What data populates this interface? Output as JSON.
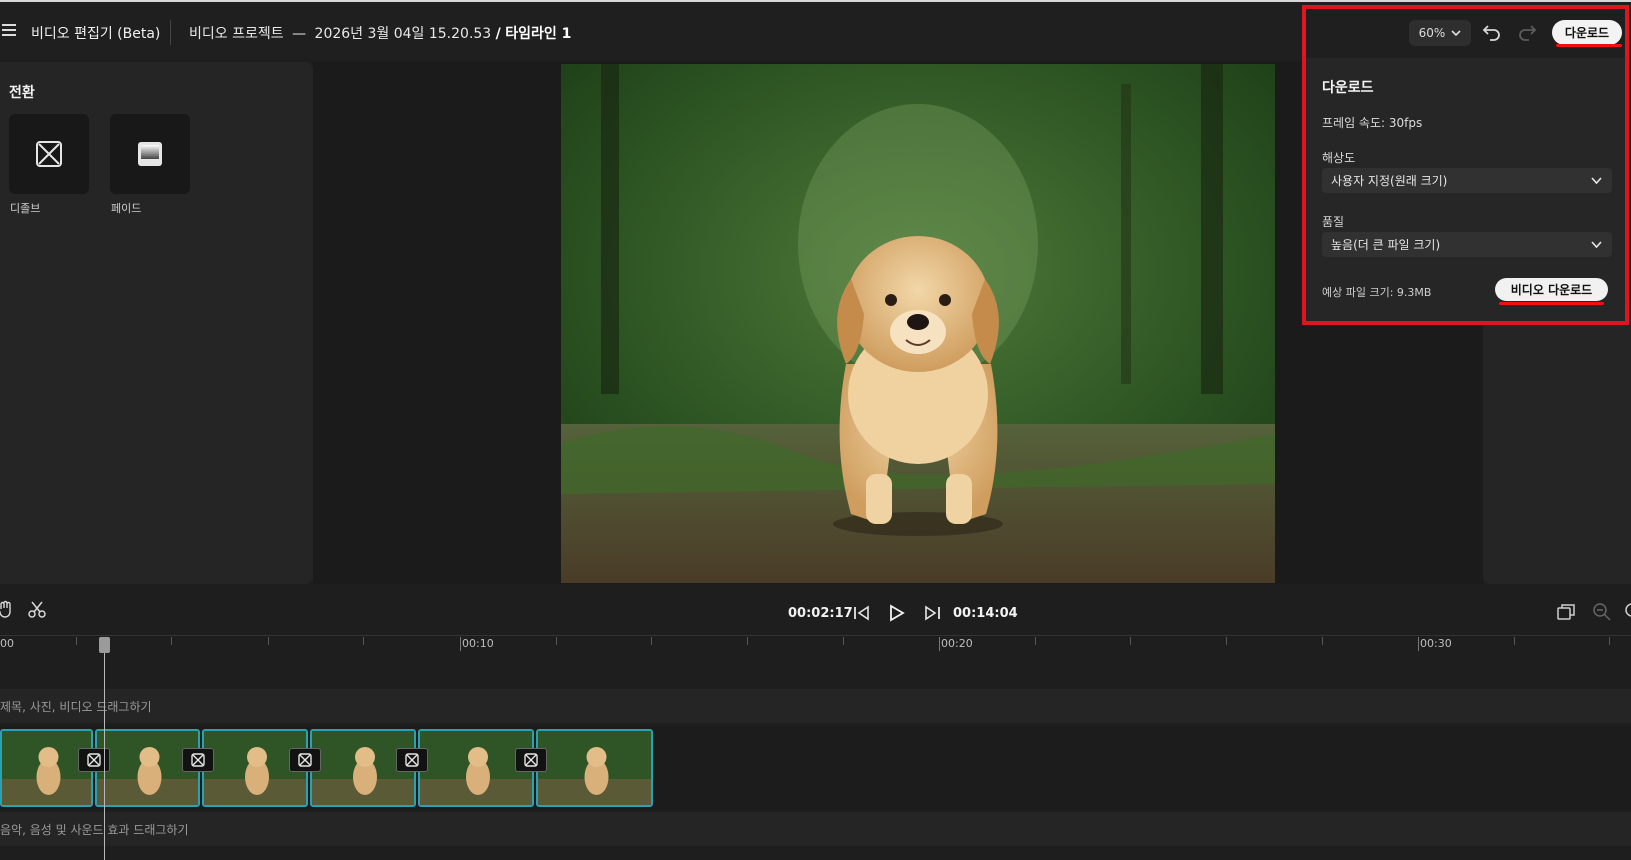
{
  "header": {
    "app_title": "비디오 편집기 (Beta)",
    "project_name": "비디오 프로젝트",
    "separator": "—",
    "project_date": "2026년 3월 04일 15.20.53",
    "slash": "/",
    "timeline_name": "타임라인 1",
    "zoom": "60%",
    "download_label": "다운로드"
  },
  "transitions_panel": {
    "title": "전환",
    "items": [
      {
        "label": "디졸브",
        "icon": "dissolve-icon"
      },
      {
        "label": "페이드",
        "icon": "fade-icon"
      }
    ]
  },
  "download_panel": {
    "title": "다운로드",
    "frame_rate": "프레임 속도: 30fps",
    "resolution_label": "해상도",
    "resolution_value": "사용자 지정(원래 크기)",
    "quality_label": "품질",
    "quality_value": "높음(더 큰 파일 크기)",
    "estimated_size": "예상 파일 크기: 9.3MB",
    "download_button": "비디오 다운로드"
  },
  "transport": {
    "current_time": "00:02:17",
    "total_time": "00:14:04"
  },
  "ruler": {
    "labels": [
      "00",
      "00:10",
      "00:20",
      "00:30"
    ]
  },
  "tracks": {
    "title_hint": "제목, 사진, 비디오 드래그하기",
    "audio_hint": "음악, 음성 및 사운드 효과 드래그하기",
    "clip_count": 6
  },
  "colors": {
    "accent_red": "#e0141e",
    "clip_border": "#2aa2b2",
    "background": "#1e1e1e"
  }
}
